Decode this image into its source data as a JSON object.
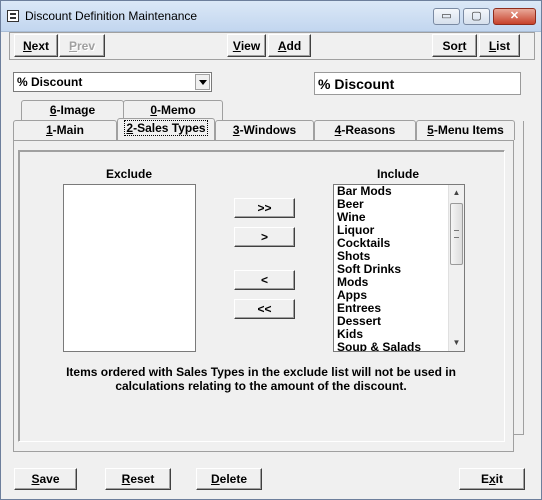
{
  "window": {
    "title": "Discount Definition Maintenance",
    "controls": {
      "minimize": "▭",
      "maximize": "▢",
      "close": "✕"
    }
  },
  "toolbar": {
    "next": {
      "hot": "N",
      "rest": "ext"
    },
    "prev": {
      "hot": "P",
      "rest": "rev"
    },
    "view": {
      "hot": "V",
      "rest": "iew"
    },
    "add": {
      "hot": "A",
      "rest": "dd"
    },
    "sort": {
      "pre": "So",
      "hot": "r",
      "rest": "t"
    },
    "list": {
      "hot": "L",
      "rest": "ist"
    }
  },
  "discount_type": {
    "selected": "% Discount"
  },
  "description": {
    "value": "% Discount"
  },
  "tabs_back": [
    {
      "hot": "6",
      "rest": "-Image"
    },
    {
      "hot": "0",
      "rest": "-Memo"
    }
  ],
  "tabs_front": [
    {
      "hot": "1",
      "rest": "-Main"
    },
    {
      "hot": "2",
      "rest": "-Sales Types"
    },
    {
      "hot": "3",
      "rest": "-Windows"
    },
    {
      "hot": "4",
      "rest": "-Reasons"
    },
    {
      "hot": "5",
      "rest": "-Menu Items"
    }
  ],
  "sales_types": {
    "exclude_heading": "Exclude",
    "include_heading": "Include",
    "exclude_items": [],
    "include_items": [
      "Bar Mods",
      "Beer",
      "Wine",
      "Liquor",
      "Cocktails",
      "Shots",
      "Soft Drinks",
      "Mods",
      "Apps",
      "Entrees",
      "Dessert",
      "Kids",
      "Soup & Salads"
    ],
    "move_all_right": ">>",
    "move_right": ">",
    "move_left": "<",
    "move_all_left": "<<",
    "note": "Items ordered with Sales Types in the exclude list will not be used in calculations relating to the amount of the discount."
  },
  "footer": {
    "save": {
      "hot": "S",
      "rest": "ave"
    },
    "reset": {
      "hot": "R",
      "rest": "eset"
    },
    "delete": {
      "hot": "D",
      "rest": "elete"
    },
    "exit": {
      "pre": "E",
      "hot": "x",
      "rest": "it"
    }
  }
}
